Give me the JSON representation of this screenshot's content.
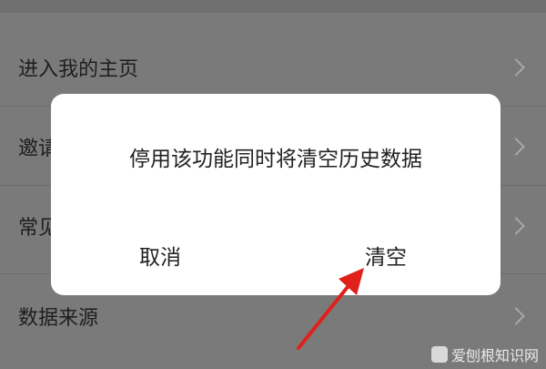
{
  "list": {
    "items": [
      {
        "label": "进入我的主页"
      },
      {
        "label": "邀请"
      },
      {
        "label": "常见"
      },
      {
        "label": "数据来源"
      }
    ]
  },
  "dialog": {
    "message": "停用该功能同时将清空历史数据",
    "cancel_label": "取消",
    "clear_label": "清空"
  },
  "watermark": {
    "text": "爱刨根知识网"
  },
  "colors": {
    "overlay": "#7a7a7a",
    "dialog_bg": "#ffffff",
    "arrow": "#e0201b"
  },
  "icons": [
    "chevron-right-icon",
    "red-arrow-pointer"
  ]
}
